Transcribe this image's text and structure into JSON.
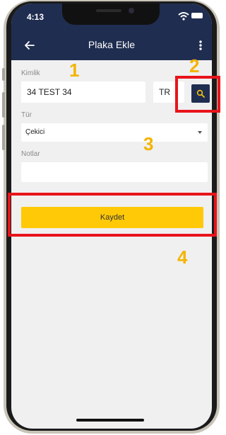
{
  "status_bar": {
    "time": "4:13"
  },
  "app_bar": {
    "title": "Plaka Ekle"
  },
  "form": {
    "kimlik_label": "Kimlik",
    "kimlik_value": "34 TEST 34",
    "country_code": "TR",
    "tur_label": "Tür",
    "tur_value": "Çekici",
    "notlar_label": "Notlar",
    "notlar_value": ""
  },
  "save_button": {
    "label": "Kaydet"
  },
  "annotations": {
    "n1": "1",
    "n2": "2",
    "n3": "3",
    "n4": "4"
  },
  "colors": {
    "primary": "#1f2d50",
    "accent": "#ffc907",
    "annotation_number": "#f4b400",
    "annotation_box": "#e8141b",
    "background": "#f0f0f1"
  },
  "icons": [
    "back-arrow-icon",
    "more-vertical-icon",
    "search-icon",
    "wifi-icon",
    "battery-icon",
    "dropdown-arrow-icon"
  ]
}
